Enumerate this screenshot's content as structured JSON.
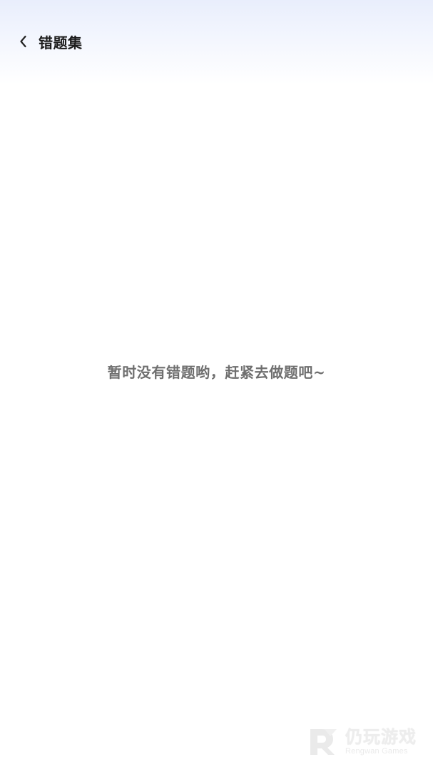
{
  "header": {
    "back_icon": "chevron-left-icon",
    "title": "错题集"
  },
  "main": {
    "empty_message": "暂时没有错题哟，赶紧去做题吧~"
  },
  "watermark": {
    "brand_cn": "仍玩游戏",
    "brand_en": "Rengwan Games"
  },
  "colors": {
    "header_gradient_top": "#e9eefc",
    "background": "#ffffff",
    "title_text": "#1c1c1c",
    "empty_text": "#6f6f6f"
  }
}
